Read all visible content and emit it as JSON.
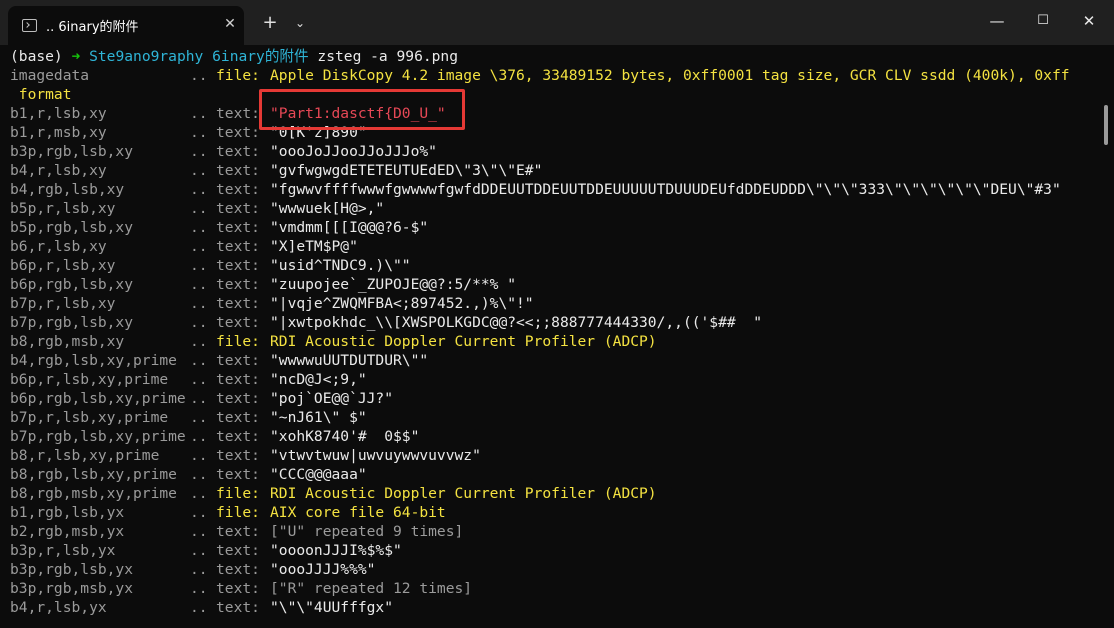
{
  "window": {
    "tab_title": ".. 6inary的附件",
    "close_tab": "✕",
    "new_tab": "+",
    "dropdown": "⌄",
    "min": "—",
    "max": "☐",
    "close": "✕"
  },
  "prompt": {
    "env": "(base)",
    "arrow": "➜",
    "path": "Ste9ano9raphy 6inary的附件",
    "command": "zsteg -a 996.png"
  },
  "rows": [
    {
      "key": "imagedata",
      "sep": "..",
      "type": "file:",
      "val": "Apple DiskCopy 4.2 image \\376, 33489152 bytes, 0xff0001 tag size, GCR CLV ssdd (400k), 0xff",
      "vclass": "y",
      "tclass": "y"
    },
    {
      "key": "",
      "sep": "",
      "type": "",
      "val": " format",
      "vclass": "y",
      "tclass": "y"
    },
    {
      "key": "b1,r,lsb,xy",
      "sep": "..",
      "type": "text:",
      "val": "\"Part1:dasctf{D0_U_\"",
      "vclass": "r",
      "tclass": "g"
    },
    {
      "key": "b1,r,msb,xy",
      "sep": "..",
      "type": "text:",
      "val": "\"0[K'z]890\"",
      "vclass": "w",
      "tclass": "g"
    },
    {
      "key": "b3p,rgb,lsb,xy",
      "sep": "..",
      "type": "text:",
      "val": "\"oooJoJJooJJoJJJo%\"",
      "vclass": "w",
      "tclass": "g"
    },
    {
      "key": "b4,r,lsb,xy",
      "sep": "..",
      "type": "text:",
      "val": "\"gvfwgwgdETETEUTUEdED\\\"3\\\"\\\"E#\"",
      "vclass": "w",
      "tclass": "g"
    },
    {
      "key": "b4,rgb,lsb,xy",
      "sep": "..",
      "type": "text:",
      "val": "\"fgwwvffffwwwfgwwwwfgwfdDDEUUTDDEUUTDDEUUUUUTDUUUDEUfdDDEUDDD\\\"\\\"\\\"333\\\"\\\"\\\"\\\"\\\"\\\"DEU\\\"#3\"",
      "vclass": "w",
      "tclass": "g"
    },
    {
      "key": "b5p,r,lsb,xy",
      "sep": "..",
      "type": "text:",
      "val": "\"wwwuek[H@>,\"",
      "vclass": "w",
      "tclass": "g"
    },
    {
      "key": "b5p,rgb,lsb,xy",
      "sep": "..",
      "type": "text:",
      "val": "\"vmdmm[[[I@@@?6-$\"",
      "vclass": "w",
      "tclass": "g"
    },
    {
      "key": "b6,r,lsb,xy",
      "sep": "..",
      "type": "text:",
      "val": "\"X]eTM$P@\"",
      "vclass": "w",
      "tclass": "g"
    },
    {
      "key": "b6p,r,lsb,xy",
      "sep": "..",
      "type": "text:",
      "val": "\"usid^TNDC9.)\\\"\"",
      "vclass": "w",
      "tclass": "g"
    },
    {
      "key": "b6p,rgb,lsb,xy",
      "sep": "..",
      "type": "text:",
      "val": "\"zuupojee`_ZUPOJE@@?:5/**% \"",
      "vclass": "w",
      "tclass": "g"
    },
    {
      "key": "b7p,r,lsb,xy",
      "sep": "..",
      "type": "text:",
      "val": "\"|vqje^ZWQMFBA<;897452.,)%\\\"!\"",
      "vclass": "w",
      "tclass": "g"
    },
    {
      "key": "b7p,rgb,lsb,xy",
      "sep": "..",
      "type": "text:",
      "val": "\"|xwtpokhdc_\\\\[XWSPOLKGDC@@?<<;;888777444330/,,(('$##  \"",
      "vclass": "w",
      "tclass": "g"
    },
    {
      "key": "b8,rgb,msb,xy",
      "sep": "..",
      "type": "file:",
      "val": "RDI Acoustic Doppler Current Profiler (ADCP)",
      "vclass": "y",
      "tclass": "y"
    },
    {
      "key": "b4,rgb,lsb,xy,prime",
      "sep": "..",
      "type": "text:",
      "val": "\"wwwwuUUTDUTDUR\\\"\"",
      "vclass": "w",
      "tclass": "g"
    },
    {
      "key": "b6p,r,lsb,xy,prime",
      "sep": "..",
      "type": "text:",
      "val": "\"ncD@J<;9,\"",
      "vclass": "w",
      "tclass": "g"
    },
    {
      "key": "b6p,rgb,lsb,xy,prime",
      "sep": "..",
      "type": "text:",
      "val": "\"poj`OE@@`JJ?\"",
      "vclass": "w",
      "tclass": "g"
    },
    {
      "key": "b7p,r,lsb,xy,prime",
      "sep": "..",
      "type": "text:",
      "val": "\"~nJ61\\\" $\"",
      "vclass": "w",
      "tclass": "g"
    },
    {
      "key": "b7p,rgb,lsb,xy,prime",
      "sep": "..",
      "type": "text:",
      "val": "\"xohK8740'#  0$$\"",
      "vclass": "w",
      "tclass": "g"
    },
    {
      "key": "b8,r,lsb,xy,prime",
      "sep": "..",
      "type": "text:",
      "val": "\"vtwvtwuw|uwvuywwvuvvwz\"",
      "vclass": "w",
      "tclass": "g"
    },
    {
      "key": "b8,rgb,lsb,xy,prime",
      "sep": "..",
      "type": "text:",
      "val": "\"CCC@@@aaa\"",
      "vclass": "w",
      "tclass": "g"
    },
    {
      "key": "b8,rgb,msb,xy,prime",
      "sep": "..",
      "type": "file:",
      "val": "RDI Acoustic Doppler Current Profiler (ADCP)",
      "vclass": "y",
      "tclass": "y"
    },
    {
      "key": "b1,rgb,lsb,yx",
      "sep": "..",
      "type": "file:",
      "val": "AIX core file 64-bit",
      "vclass": "y",
      "tclass": "y"
    },
    {
      "key": "b2,rgb,msb,yx",
      "sep": "..",
      "type": "text:",
      "val": "[\"U\" repeated 9 times]",
      "vclass": "g",
      "tclass": "g"
    },
    {
      "key": "b3p,r,lsb,yx",
      "sep": "..",
      "type": "text:",
      "val": "\"oooonJJJI%$%$\"",
      "vclass": "w",
      "tclass": "g"
    },
    {
      "key": "b3p,rgb,lsb,yx",
      "sep": "..",
      "type": "text:",
      "val": "\"oooJJJJ%%%\"",
      "vclass": "w",
      "tclass": "g"
    },
    {
      "key": "b3p,rgb,msb,yx",
      "sep": "..",
      "type": "text:",
      "val": "[\"R\" repeated 12 times]",
      "vclass": "g",
      "tclass": "g"
    },
    {
      "key": "b4,r,lsb,yx",
      "sep": "..",
      "type": "text:",
      "val": "\"\\\"\\\"4UUfffgx\"",
      "vclass": "w",
      "tclass": "g"
    }
  ],
  "colors": {
    "background": "#0c0c0c",
    "highlight": "#e53935",
    "yellow": "#f4e241",
    "cyan": "#2fb4d6"
  }
}
